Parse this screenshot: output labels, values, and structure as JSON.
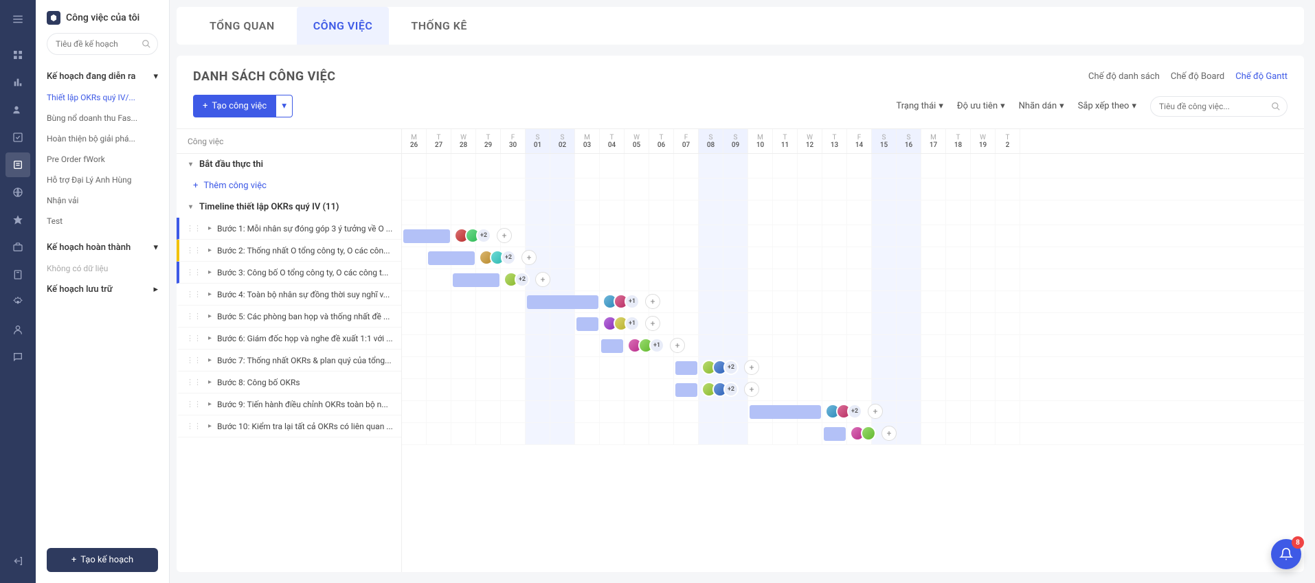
{
  "sidebar": {
    "title": "Công việc của tôi",
    "search_placeholder": "Tiêu đề kế hoạch",
    "sections": {
      "ongoing": {
        "label": "Kế hoạch đang diễn ra",
        "items": [
          "Thiết lập OKRs quý IV/...",
          "Bùng nổ doanh thu Fas...",
          "Hoàn thiện bộ giải phá...",
          "Pre Order fWork",
          "Hỗ trợ Đại Lý Anh Hùng",
          "Nhận vải",
          "Test"
        ]
      },
      "done": {
        "label": "Kế hoạch hoàn thành",
        "empty": "Không có dữ liệu"
      },
      "archive": {
        "label": "Kế hoạch lưu trữ"
      }
    },
    "create_plan": "Tạo kế hoạch"
  },
  "tabs": {
    "overview": "TỔNG QUAN",
    "tasks": "CÔNG VIỆC",
    "stats": "THỐNG KÊ"
  },
  "panel": {
    "title": "DANH SÁCH CÔNG VIỆC",
    "views": {
      "list": "Chế độ danh sách",
      "board": "Chế độ Board",
      "gantt": "Chế độ Gantt"
    },
    "create_task": "Tạo công việc",
    "filters": {
      "status": "Trạng thái",
      "priority": "Độ ưu tiên",
      "label": "Nhãn dán",
      "sort": "Sắp xếp theo"
    },
    "search_placeholder": "Tiêu đề công việc..."
  },
  "gantt": {
    "col_header": "Công việc",
    "days": [
      {
        "dow": "M",
        "num": "26",
        "weekend": false
      },
      {
        "dow": "T",
        "num": "27",
        "weekend": false
      },
      {
        "dow": "W",
        "num": "28",
        "weekend": false
      },
      {
        "dow": "T",
        "num": "29",
        "weekend": false
      },
      {
        "dow": "F",
        "num": "30",
        "weekend": false
      },
      {
        "dow": "S",
        "num": "01",
        "weekend": true
      },
      {
        "dow": "S",
        "num": "02",
        "weekend": true
      },
      {
        "dow": "M",
        "num": "03",
        "weekend": false
      },
      {
        "dow": "T",
        "num": "04",
        "weekend": false
      },
      {
        "dow": "W",
        "num": "05",
        "weekend": false
      },
      {
        "dow": "T",
        "num": "06",
        "weekend": false
      },
      {
        "dow": "F",
        "num": "07",
        "weekend": false
      },
      {
        "dow": "S",
        "num": "08",
        "weekend": true
      },
      {
        "dow": "S",
        "num": "09",
        "weekend": true
      },
      {
        "dow": "M",
        "num": "10",
        "weekend": false
      },
      {
        "dow": "T",
        "num": "11",
        "weekend": false
      },
      {
        "dow": "W",
        "num": "12",
        "weekend": false
      },
      {
        "dow": "T",
        "num": "13",
        "weekend": false
      },
      {
        "dow": "F",
        "num": "14",
        "weekend": false
      },
      {
        "dow": "S",
        "num": "15",
        "weekend": true
      },
      {
        "dow": "S",
        "num": "16",
        "weekend": true
      },
      {
        "dow": "M",
        "num": "17",
        "weekend": false
      },
      {
        "dow": "T",
        "num": "18",
        "weekend": false
      },
      {
        "dow": "W",
        "num": "19",
        "weekend": false
      },
      {
        "dow": "T",
        "num": "2",
        "weekend": false
      }
    ],
    "groups": [
      {
        "label": "Bắt đầu thực thi",
        "add": "Thêm công việc",
        "tasks": []
      },
      {
        "label": "Timeline thiết lập OKRs quý IV (11)",
        "tasks": [
          {
            "title": "Bước 1: Mỗi nhân sự đóng góp 3 ý tưởng về O ...",
            "color": "#3e5ae6",
            "start": 0,
            "len": 2,
            "avatars": 2,
            "more": "+2"
          },
          {
            "title": "Bước 2: Thống nhất O tổng công ty, O các côn...",
            "color": "#f2c200",
            "start": 1,
            "len": 2,
            "avatars": 2,
            "more": "+2"
          },
          {
            "title": "Bước 3: Công bố O tổng công ty, O các công t...",
            "color": "#3e5ae6",
            "start": 2,
            "len": 2,
            "avatars": 1,
            "more": "+2"
          },
          {
            "title": "Bước 4: Toàn bộ nhân sự đồng thời suy nghĩ v...",
            "color": "",
            "start": 5,
            "len": 3,
            "avatars": 2,
            "more": "+1"
          },
          {
            "title": "Bước 5: Các phòng ban họp và thống nhất đề ...",
            "color": "",
            "start": 7,
            "len": 1,
            "avatars": 2,
            "more": "+1"
          },
          {
            "title": "Bước 6: Giám đốc họp và nghe đề xuất 1:1 với ...",
            "color": "",
            "start": 8,
            "len": 1,
            "avatars": 2,
            "more": "+1"
          },
          {
            "title": "Bước 7: Thống nhất OKRs & plan quý của tổng...",
            "color": "",
            "start": 11,
            "len": 1,
            "avatars": 2,
            "more": "+2"
          },
          {
            "title": "Bước 8: Công bố OKRs",
            "color": "",
            "start": 11,
            "len": 1,
            "avatars": 2,
            "more": "+2"
          },
          {
            "title": "Bước 9: Tiến hành điều chỉnh OKRs toàn bộ n...",
            "color": "",
            "start": 14,
            "len": 3,
            "avatars": 2,
            "more": "+2"
          },
          {
            "title": "Bước 10: Kiểm tra lại tất cả OKRs có liên quan ...",
            "color": "",
            "start": 17,
            "len": 1,
            "avatars": 2,
            "more": ""
          }
        ]
      }
    ]
  },
  "notif_count": "8"
}
